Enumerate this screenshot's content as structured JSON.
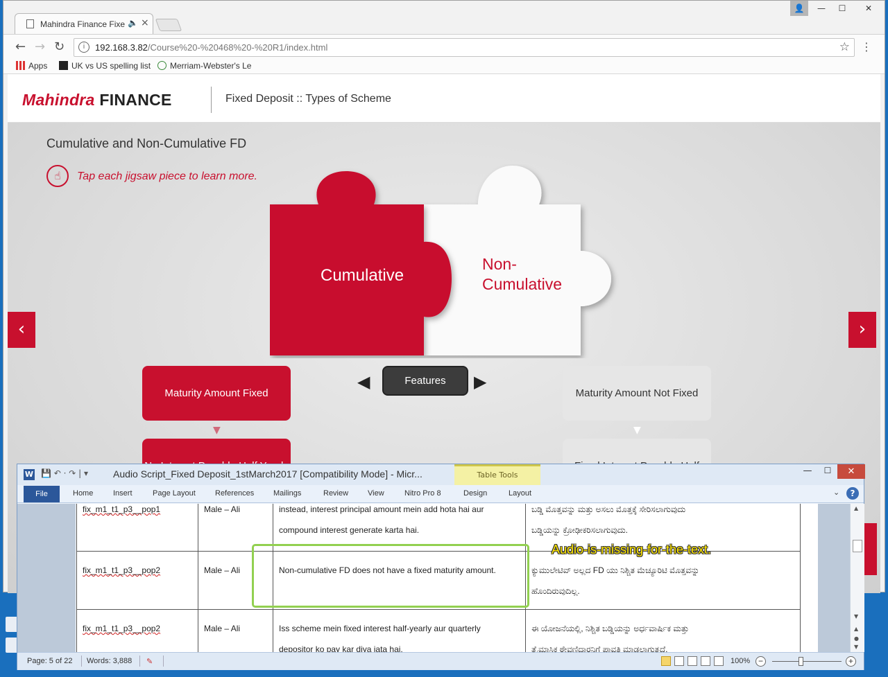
{
  "browser": {
    "tab_title": "Mahindra Finance Fixe",
    "url_host": "192.168.3.82",
    "url_path": "/Course%20-%20468%20-%20R1/index.html",
    "bookmarks": [
      "Apps",
      "UK vs US spelling list",
      "Merriam-Webster's Le"
    ]
  },
  "header": {
    "logo_mahindra": "Mahindra",
    "logo_finance": "FINANCE",
    "title": "Fixed Deposit :: Types of Scheme"
  },
  "stage": {
    "subtitle": "Cumulative and Non-Cumulative FD",
    "instruction": "Tap each jigsaw piece to learn more.",
    "puzzle_left": "Cumulative",
    "puzzle_right_line1": "Non-",
    "puzzle_right_line2": "Cumulative",
    "features_label": "Features",
    "left_boxes": [
      "Maturity Amount Fixed",
      "No Interest Payable Half Yearly"
    ],
    "right_boxes": [
      "Maturity Amount Not Fixed",
      "Fixed Interest Payable Half"
    ]
  },
  "word": {
    "title": "Audio Script_Fixed Deposit_1stMarch2017 [Compatibility Mode]  -  Micr...",
    "table_tools": "Table Tools",
    "ribbon_tabs": [
      "File",
      "Home",
      "Insert",
      "Page Layout",
      "References",
      "Mailings",
      "Review",
      "View",
      "Nitro Pro 8",
      "Design",
      "Layout"
    ],
    "rows": [
      {
        "id": "fix_m1_t1_p3__pop1",
        "voice": "Male  –  Ali",
        "english_line1": "instead, interest principal amount mein add hota hai aur",
        "english_line2": "compound interest generate karta hai.",
        "kannada_line1": "ಬಡ್ಡಿ ಮೊತ್ತವನ್ನು ಮತ್ತು ಅಸಲು ಮೊತ್ತಕ್ಕೆ ಸೇರಿಸಲಾಗುವುದು",
        "kannada_line2": "ಬಡ್ಡಿಯನ್ನು ಕ್ರೋಢೀಕರಿಸಲಾಗುವುದು."
      },
      {
        "id": "fix_m1_t1_p3__pop2",
        "voice": "Male  –  Ali",
        "english_line1": "Non-cumulative FD does not have a fixed maturity amount.",
        "english_line2": "",
        "kannada_line1": "ಕ್ಯುಮುಲೇಟಿವ್ ಅಲ್ಲದ FD ಯು ನಿಶ್ಚಿತ ಮೆಚ್ಯೂರಿಟಿ ಮೊತ್ತವನ್ನು",
        "kannada_line2": "ಹೊಂದಿರುವುದಿಲ್ಲ."
      },
      {
        "id": "fix_m1_t1_p3__pop2",
        "voice": "Male  –  Ali",
        "english_line1": "Iss scheme mein fixed interest half-yearly aur quarterly",
        "english_line2": "depositor ko pay kar diya jata hai.",
        "kannada_line1": "ಈ ಯೋಜನೆಯಲ್ಲಿ, ನಿಶ್ಚಿತ ಬಡ್ಡಿಯನ್ನು ಅರ್ಧವಾರ್ಷಿಕ ಮತ್ತು",
        "kannada_line2": "ತ್ರೈಮಾಸಿಕ ಠೇವಣಿದಾರನಿಗೆ ಪಾವತಿ ಮಾಡಲಾಗುತ್ತದೆ."
      }
    ],
    "annotation": "Audio-is-missing-for-the-text.",
    "status_page": "Page: 5 of 22",
    "status_words": "Words: 3,888",
    "zoom": "100%"
  },
  "colors": {
    "brand_red": "#c8102e",
    "annotation_yellow": "#ffe600",
    "highlight_green": "#92d050"
  }
}
